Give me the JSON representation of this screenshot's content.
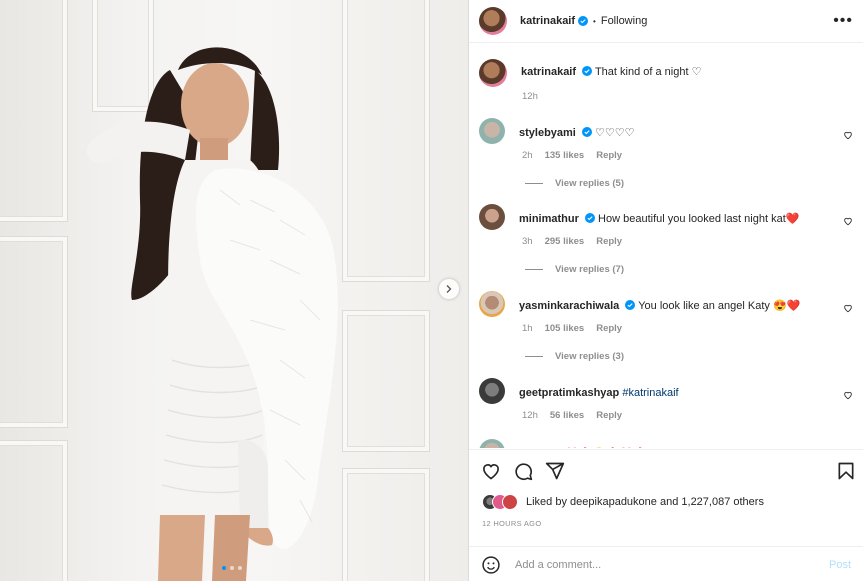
{
  "header": {
    "username": "katrinakaif",
    "separator": "•",
    "follow_status": "Following",
    "more_label": "•••"
  },
  "caption": {
    "username": "katrinakaif",
    "text": "That kind of a night ♡",
    "time": "12h"
  },
  "comments": [
    {
      "username": "stylebyami",
      "verified": true,
      "text": "♡♡♡♡",
      "time": "2h",
      "likes": "135 likes",
      "reply": "Reply",
      "view_replies": "View replies (5)"
    },
    {
      "username": "minimathur",
      "verified": true,
      "text": "How beautiful you looked last night kat❤️",
      "time": "3h",
      "likes": "295 likes",
      "reply": "Reply",
      "view_replies": "View replies (7)"
    },
    {
      "username": "yasminkarachiwala",
      "verified": true,
      "text": "You look like an angel Katy 😍❤️",
      "time": "1h",
      "likes": "105 likes",
      "reply": "Reply",
      "view_replies": "View replies (3)"
    },
    {
      "username": "geetpratimkashyap",
      "verified": false,
      "text": "#katrinakaif",
      "time": "12h",
      "likes": "56 likes",
      "reply": "Reply",
      "view_replies": ""
    }
  ],
  "partial_comment": {
    "text": "❤️🔥😍🔥❤️🔥"
  },
  "likes": {
    "prefix": "Liked by",
    "user": "deepikapadukone",
    "joiner": "and",
    "count": "1,227,087 others"
  },
  "timestamp": "12 HOURS AGO",
  "add_comment": {
    "placeholder": "Add a comment...",
    "post_label": "Post"
  },
  "carousel": {
    "total": 3,
    "active": 0
  },
  "icons": [
    "verified-badge-icon",
    "more-icon",
    "heart-icon",
    "comment-icon",
    "share-icon",
    "bookmark-icon",
    "emoji-icon",
    "next-arrow-icon"
  ],
  "colors": {
    "accent": "#0095f6",
    "muted": "#8e8e8e",
    "text": "#262626",
    "link": "#00376b"
  }
}
